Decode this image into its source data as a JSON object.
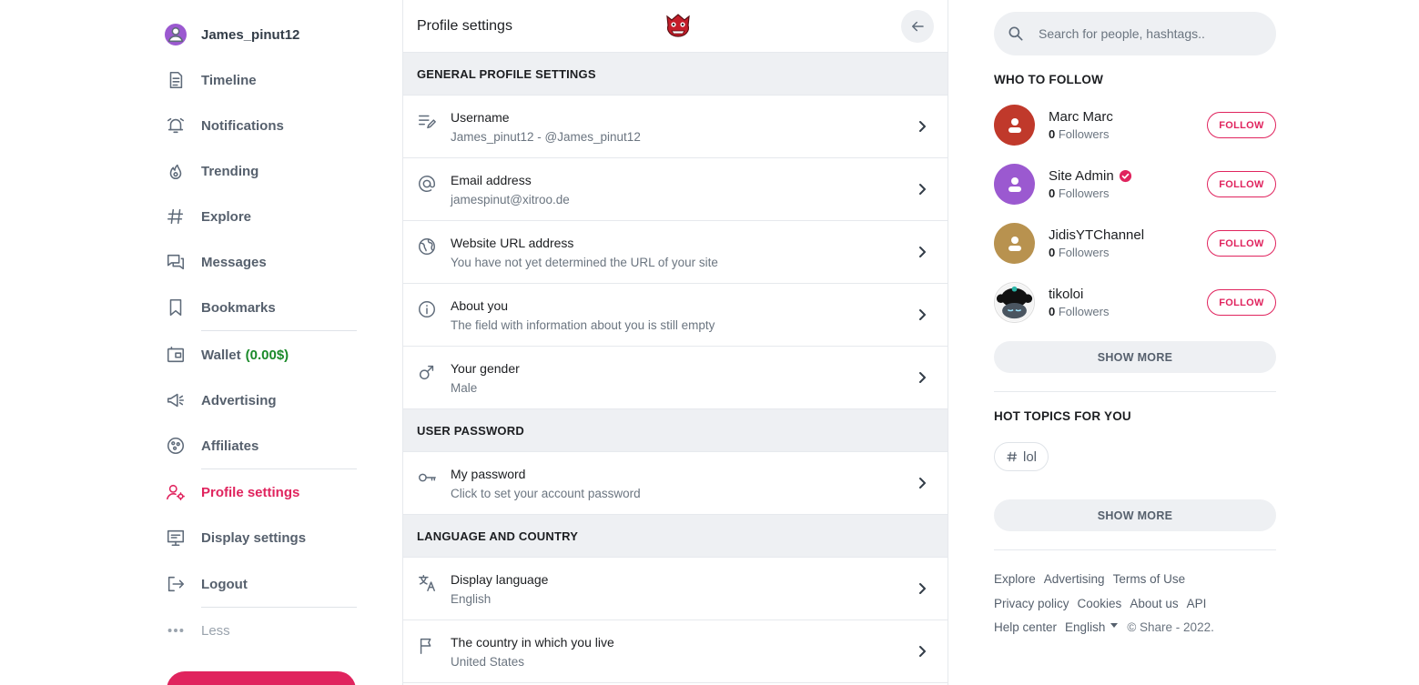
{
  "sidebar": {
    "user": {
      "name": "James_pinut12"
    },
    "items": [
      {
        "key": "timeline",
        "label": "Timeline",
        "icon": "document-icon"
      },
      {
        "key": "notifications",
        "label": "Notifications",
        "icon": "alarm-icon"
      },
      {
        "key": "trending",
        "label": "Trending",
        "icon": "flame-icon"
      },
      {
        "key": "explore",
        "label": "Explore",
        "icon": "hashtag-icon"
      },
      {
        "key": "messages",
        "label": "Messages",
        "icon": "chat-icon"
      },
      {
        "key": "bookmarks",
        "label": "Bookmarks",
        "icon": "bookmark-icon"
      },
      {
        "key": "wallet",
        "label": "Wallet",
        "amount": "(0.00$)",
        "icon": "wallet-icon"
      },
      {
        "key": "advertising",
        "label": "Advertising",
        "icon": "megaphone-icon"
      },
      {
        "key": "affiliates",
        "label": "Affiliates",
        "icon": "affiliates-icon"
      },
      {
        "key": "profile_settings",
        "label": "Profile settings",
        "icon": "user-gear-icon",
        "active": true
      },
      {
        "key": "display_settings",
        "label": "Display settings",
        "icon": "monitor-icon"
      },
      {
        "key": "logout",
        "label": "Logout",
        "icon": "logout-icon"
      },
      {
        "key": "less",
        "label": "Less",
        "icon": "more-dots-icon"
      }
    ],
    "accent_color": "#e0245e",
    "wallet_color": "#1b8a2a"
  },
  "panel": {
    "title": "Profile settings",
    "sections": [
      {
        "heading": "GENERAL PROFILE SETTINGS",
        "rows": [
          {
            "title": "Username",
            "value": "James_pinut12 - @James_pinut12",
            "icon": "edit-lines-icon"
          },
          {
            "title": "Email address",
            "value": "jamespinut@xitroo.de",
            "icon": "at-icon"
          },
          {
            "title": "Website URL address",
            "value": "You have not yet determined the URL of your site",
            "icon": "globe-icon"
          },
          {
            "title": "About you",
            "value": "The field with information about you is still empty",
            "icon": "info-icon"
          },
          {
            "title": "Your gender",
            "value": "Male",
            "icon": "male-icon"
          }
        ]
      },
      {
        "heading": "USER PASSWORD",
        "rows": [
          {
            "title": "My password",
            "value": "Click to set your account password",
            "icon": "key-icon"
          }
        ]
      },
      {
        "heading": "LANGUAGE AND COUNTRY",
        "rows": [
          {
            "title": "Display language",
            "value": "English",
            "icon": "translate-icon"
          },
          {
            "title": "The country in which you live",
            "value": "United States",
            "icon": "flag-icon"
          }
        ]
      }
    ]
  },
  "right": {
    "search": {
      "placeholder": "Search for people, hashtags.."
    },
    "who_to_follow": {
      "heading": "WHO TO FOLLOW",
      "people": [
        {
          "name": "Marc Marc",
          "count": "0",
          "suffix": "Followers",
          "color": "#c0392b",
          "verified": false
        },
        {
          "name": "Site Admin",
          "count": "0",
          "suffix": "Followers",
          "color": "#9b59d0",
          "verified": true
        },
        {
          "name": "JidisYTChannel",
          "count": "0",
          "suffix": "Followers",
          "color": "#b8924f",
          "verified": false
        },
        {
          "name": "tikoloi",
          "count": "0",
          "suffix": "Followers",
          "color": "#111111",
          "verified": false
        }
      ],
      "follow_label": "FOLLOW",
      "show_more": "SHOW MORE"
    },
    "hot_topics": {
      "heading": "HOT TOPICS FOR YOU",
      "tags": [
        "lol"
      ],
      "show_more": "SHOW MORE"
    },
    "footer": {
      "links": [
        "Explore",
        "Advertising",
        "Terms of Use",
        "Privacy policy",
        "Cookies",
        "About us",
        "API",
        "Help center"
      ],
      "language": "English",
      "copyright": "© Share - 2022."
    }
  }
}
